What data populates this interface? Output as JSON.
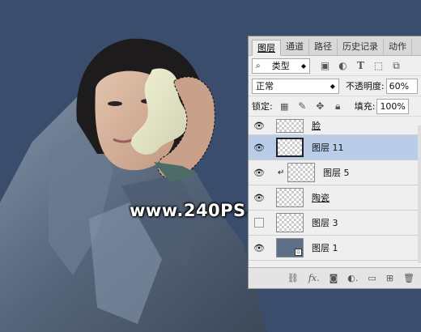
{
  "watermark": "www.240PS.com",
  "panel": {
    "tabs": [
      "图层",
      "通道",
      "路径",
      "历史记录",
      "动作"
    ],
    "filter": {
      "label": "类型",
      "icons": [
        "image-filter-icon",
        "adjustment-filter-icon",
        "type-filter-icon",
        "shape-filter-icon",
        "smart-object-filter-icon"
      ]
    },
    "blend_mode": "正常",
    "opacity_label": "不透明度:",
    "opacity_value": "60%",
    "lock_label": "锁定:",
    "fill_label": "填充:",
    "fill_value": "100%",
    "layers": [
      {
        "name": "脸",
        "visible": true,
        "selected": false
      },
      {
        "name": "图层 11",
        "visible": true,
        "selected": true
      },
      {
        "name": "图层 5",
        "visible": true,
        "selected": false,
        "clipped": true
      },
      {
        "name": "陶瓷",
        "visible": true,
        "selected": false
      },
      {
        "name": "图层 3",
        "visible": false,
        "selected": false
      },
      {
        "name": "图层 1",
        "visible": true,
        "selected": false
      }
    ],
    "footer_icons": [
      "link-icon",
      "fx-icon",
      "mask-icon",
      "adjustment-icon",
      "group-icon",
      "new-layer-icon",
      "trash-icon"
    ]
  }
}
